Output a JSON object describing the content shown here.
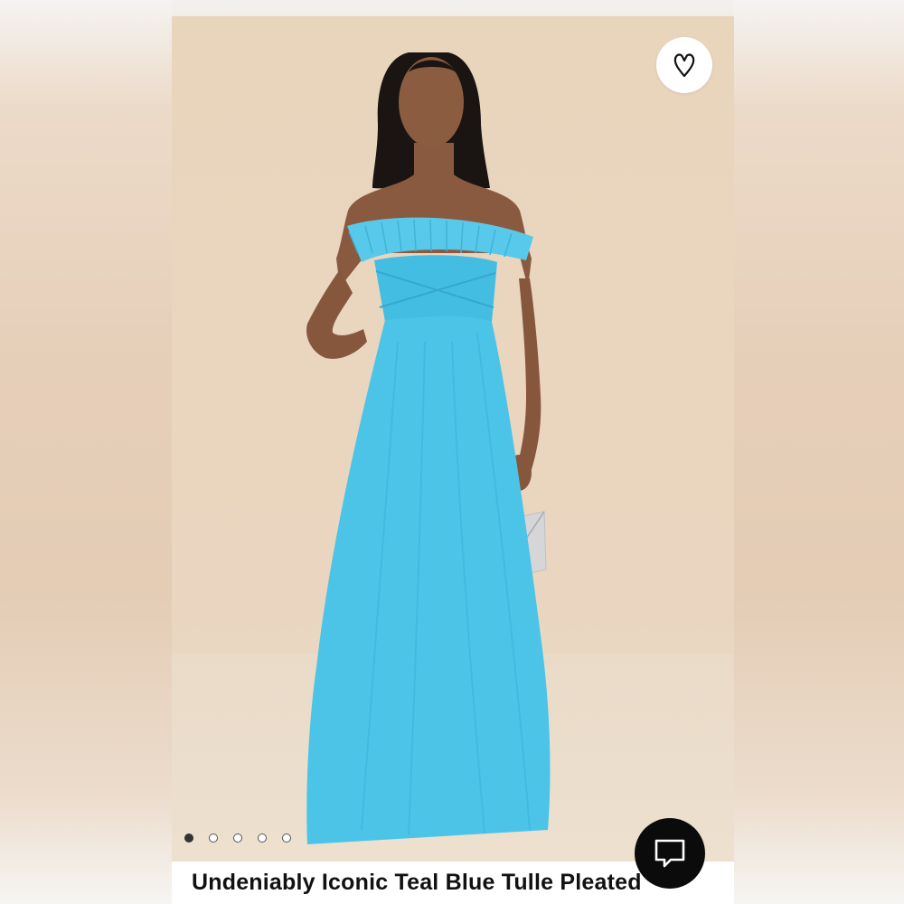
{
  "product": {
    "title": "Undeniably Iconic Teal Blue Tulle Pleated",
    "image_alt": "Model wearing teal blue strapless tulle maxi dress holding a silver clutch",
    "carousel": {
      "total": 5,
      "active": 1
    }
  },
  "icons": {
    "favorite": "heart-icon",
    "chat": "chat-icon"
  },
  "colors": {
    "dress": "#49c3e6",
    "background": "#e9d4bc",
    "chat_button": "#0b0b0b"
  }
}
